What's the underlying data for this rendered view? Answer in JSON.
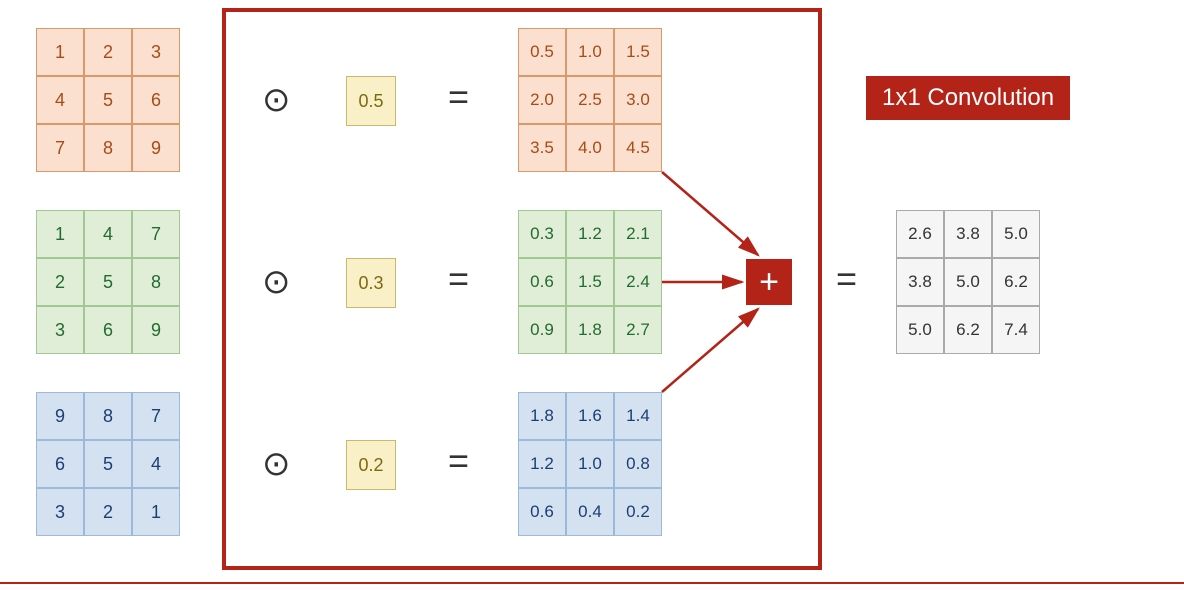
{
  "title": "1x1 Convolution",
  "channels": [
    {
      "color": "orange",
      "input": [
        "1",
        "2",
        "3",
        "4",
        "5",
        "6",
        "7",
        "8",
        "9"
      ],
      "kernel": "0.5",
      "result": [
        "0.5",
        "1.0",
        "1.5",
        "2.0",
        "2.5",
        "3.0",
        "3.5",
        "4.0",
        "4.5"
      ]
    },
    {
      "color": "green",
      "input": [
        "1",
        "4",
        "7",
        "2",
        "5",
        "8",
        "3",
        "6",
        "9"
      ],
      "kernel": "0.3",
      "result": [
        "0.3",
        "1.2",
        "2.1",
        "0.6",
        "1.5",
        "2.4",
        "0.9",
        "1.8",
        "2.7"
      ]
    },
    {
      "color": "blue",
      "input": [
        "9",
        "8",
        "7",
        "6",
        "5",
        "4",
        "3",
        "2",
        "1"
      ],
      "kernel": "0.2",
      "result": [
        "1.8",
        "1.6",
        "1.4",
        "1.2",
        "1.0",
        "0.8",
        "0.6",
        "0.4",
        "0.2"
      ]
    }
  ],
  "output": [
    "2.6",
    "3.8",
    "5.0",
    "3.8",
    "5.0",
    "6.2",
    "5.0",
    "6.2",
    "7.4"
  ],
  "ops": {
    "times": "⊙",
    "equals": "=",
    "plus": "+"
  },
  "chart_data": {
    "type": "table",
    "description": "1x1 convolution across 3 input channels",
    "inputs": [
      [
        [
          1,
          2,
          3
        ],
        [
          4,
          5,
          6
        ],
        [
          7,
          8,
          9
        ]
      ],
      [
        [
          1,
          4,
          7
        ],
        [
          2,
          5,
          8
        ],
        [
          3,
          6,
          9
        ]
      ],
      [
        [
          9,
          8,
          7
        ],
        [
          6,
          5,
          4
        ],
        [
          3,
          2,
          1
        ]
      ]
    ],
    "kernel": [
      0.5,
      0.3,
      0.2
    ],
    "per_channel_result": [
      [
        [
          0.5,
          1.0,
          1.5
        ],
        [
          2.0,
          2.5,
          3.0
        ],
        [
          3.5,
          4.0,
          4.5
        ]
      ],
      [
        [
          0.3,
          1.2,
          2.1
        ],
        [
          0.6,
          1.5,
          2.4
        ],
        [
          0.9,
          1.8,
          2.7
        ]
      ],
      [
        [
          1.8,
          1.6,
          1.4
        ],
        [
          1.2,
          1.0,
          0.8
        ],
        [
          0.6,
          0.4,
          0.2
        ]
      ]
    ],
    "output": [
      [
        2.6,
        3.8,
        5.0
      ],
      [
        3.8,
        5.0,
        6.2
      ],
      [
        5.0,
        6.2,
        7.4
      ]
    ]
  }
}
